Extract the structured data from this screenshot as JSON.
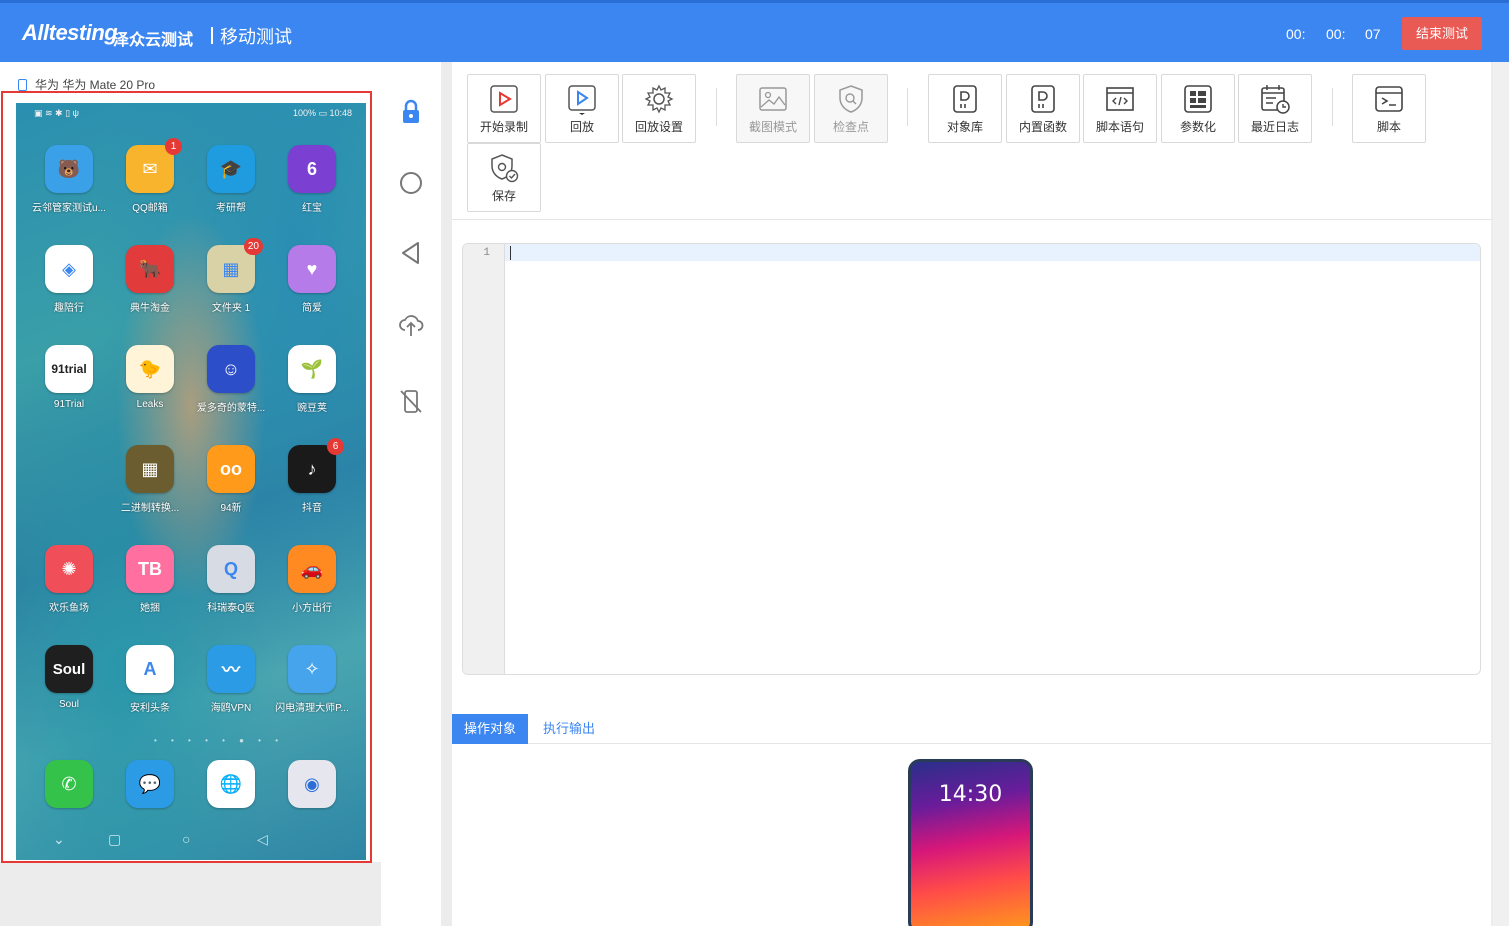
{
  "header": {
    "logo_text": "Alltesting",
    "logo_cn": "泽众云测试",
    "module_title": "移动测试",
    "timer": {
      "hours": "00:",
      "minutes": "00:",
      "seconds": "07"
    },
    "end_button": "结束测试",
    "colors": {
      "bar": "#3b86f0",
      "end_button": "#ea5a55"
    }
  },
  "device": {
    "label": "华为 华为 Mate 20 Pro",
    "status_left": "▣ ≋ ✱ ▯ ψ",
    "status_right": "100% ▭ 10:48",
    "apps": [
      {
        "label": "云邻管家测试u...",
        "icon": "bear-app-icon",
        "color": "#3aa0e8",
        "glyph": "🐻"
      },
      {
        "label": "QQ邮箱",
        "icon": "mail-app-icon",
        "color": "#f7b42c",
        "glyph": "✉",
        "badge": "1"
      },
      {
        "label": "考研帮",
        "icon": "graduation-app-icon",
        "color": "#1f9be0",
        "glyph": "🎓"
      },
      {
        "label": "红宝",
        "icon": "redbox-app-icon",
        "color": "#7b3fd1",
        "glyph": "6"
      },
      {
        "label": "趣陪行",
        "icon": "diamond-app-icon",
        "color": "#ffffff",
        "glyph": "◈"
      },
      {
        "label": "典牛淘金",
        "icon": "bull-app-icon",
        "color": "#e23b3b",
        "glyph": "🐂"
      },
      {
        "label": "文件夹 1",
        "icon": "folder-icon",
        "color": "#d9d2a6",
        "glyph": "▦",
        "badge": "20"
      },
      {
        "label": "简爱",
        "icon": "jianai-app-icon",
        "color": "#b57be8",
        "glyph": "♥"
      },
      {
        "label": "91Trial",
        "icon": "trial-app-icon",
        "color": "#ffffff",
        "glyph": "91trial"
      },
      {
        "label": "Leaks",
        "icon": "duck-app-icon",
        "color": "#fff4d8",
        "glyph": "🐤"
      },
      {
        "label": "爱多奇的蒙特...",
        "icon": "cartoon-app-icon",
        "color": "#2d4ec9",
        "glyph": "☺"
      },
      {
        "label": "豌豆荚",
        "icon": "pea-app-icon",
        "color": "#ffffff",
        "glyph": "🌱"
      },
      {
        "label": "",
        "icon": "blank-slot",
        "color": "transparent",
        "glyph": ""
      },
      {
        "label": "二进制转换...",
        "icon": "calculator-app-icon",
        "color": "#6b5d2f",
        "glyph": "▦"
      },
      {
        "label": "94新",
        "icon": "94-app-icon",
        "color": "#ff9a1a",
        "glyph": "oo"
      },
      {
        "label": "抖音",
        "icon": "tiktok-app-icon",
        "color": "#1a1a1a",
        "glyph": "♪",
        "badge": "6"
      },
      {
        "label": "欢乐鱼场",
        "icon": "aperture-app-icon",
        "color": "#f04f5a",
        "glyph": "✺"
      },
      {
        "label": "她捆",
        "icon": "tb-app-icon",
        "color": "#ff6fa0",
        "glyph": "TB"
      },
      {
        "label": "科瑞泰Q医",
        "icon": "q-app-icon",
        "color": "#d7dbe3",
        "glyph": "Q"
      },
      {
        "label": "小方出行",
        "icon": "car-app-icon",
        "color": "#ff8a22",
        "glyph": "🚗"
      },
      {
        "label": "Soul",
        "icon": "soul-app-icon",
        "color": "#1f1f1f",
        "glyph": "Soul"
      },
      {
        "label": "安利头条",
        "icon": "a-app-icon",
        "color": "#ffffff",
        "glyph": "A"
      },
      {
        "label": "海鸥VPN",
        "icon": "gull-app-icon",
        "color": "#2b9be6",
        "glyph": "〰"
      },
      {
        "label": "闪电清理大师P...",
        "icon": "cleaner-app-icon",
        "color": "#45a4ec",
        "glyph": "✧"
      }
    ],
    "dock": [
      {
        "icon": "phone-app-icon",
        "color": "#34c24a",
        "glyph": "✆"
      },
      {
        "icon": "messages-app-icon",
        "color": "#2b9be6",
        "glyph": "💬"
      },
      {
        "icon": "browser-app-icon",
        "color": "#ffffff",
        "glyph": "🌐"
      },
      {
        "icon": "camera-app-icon",
        "color": "#e6e6ee",
        "glyph": "◉"
      }
    ],
    "page_dots": "• • • • • ● • •",
    "nav": {
      "hide": "⌄",
      "recent": "▢",
      "home": "○",
      "back": "◁"
    }
  },
  "controls": [
    {
      "name": "lock-icon"
    },
    {
      "name": "home-circle-icon"
    },
    {
      "name": "back-triangle-icon"
    },
    {
      "name": "cloud-upload-icon"
    },
    {
      "name": "disconnect-device-icon"
    }
  ],
  "toolbar": {
    "buttons": [
      {
        "name": "start-record-button",
        "label": "开始录制",
        "icon": "record-icon",
        "disabled": false
      },
      {
        "name": "playback-button",
        "label": "回放",
        "icon": "play-icon",
        "disabled": false
      },
      {
        "name": "playback-settings-button",
        "label": "回放设置",
        "icon": "gear-icon",
        "disabled": false
      },
      {
        "name": "screenshot-mode-button",
        "label": "截图模式",
        "icon": "image-icon",
        "disabled": true
      },
      {
        "name": "checkpoint-button",
        "label": "检查点",
        "icon": "shield-search-icon",
        "disabled": true
      },
      {
        "name": "object-library-button",
        "label": "对象库",
        "icon": "doc-d-icon",
        "disabled": false
      },
      {
        "name": "builtin-functions-button",
        "label": "内置函数",
        "icon": "doc-d-icon",
        "disabled": false
      },
      {
        "name": "script-statement-button",
        "label": "脚本语句",
        "icon": "code-window-icon",
        "disabled": false
      },
      {
        "name": "parameterize-button",
        "label": "参数化",
        "icon": "grid-list-icon",
        "disabled": false
      },
      {
        "name": "recent-log-button",
        "label": "最近日志",
        "icon": "calendar-clock-icon",
        "disabled": false
      },
      {
        "name": "script-button",
        "label": "脚本",
        "icon": "terminal-icon",
        "disabled": false
      },
      {
        "name": "save-button",
        "label": "保存",
        "icon": "shield-gear-icon",
        "disabled": false
      }
    ]
  },
  "editor": {
    "line_number": "1",
    "content": ""
  },
  "bottom_panel": {
    "tabs": [
      {
        "label": "操作对象",
        "active": true
      },
      {
        "label": "执行输出",
        "active": false
      }
    ],
    "preview_time": "14:30"
  }
}
